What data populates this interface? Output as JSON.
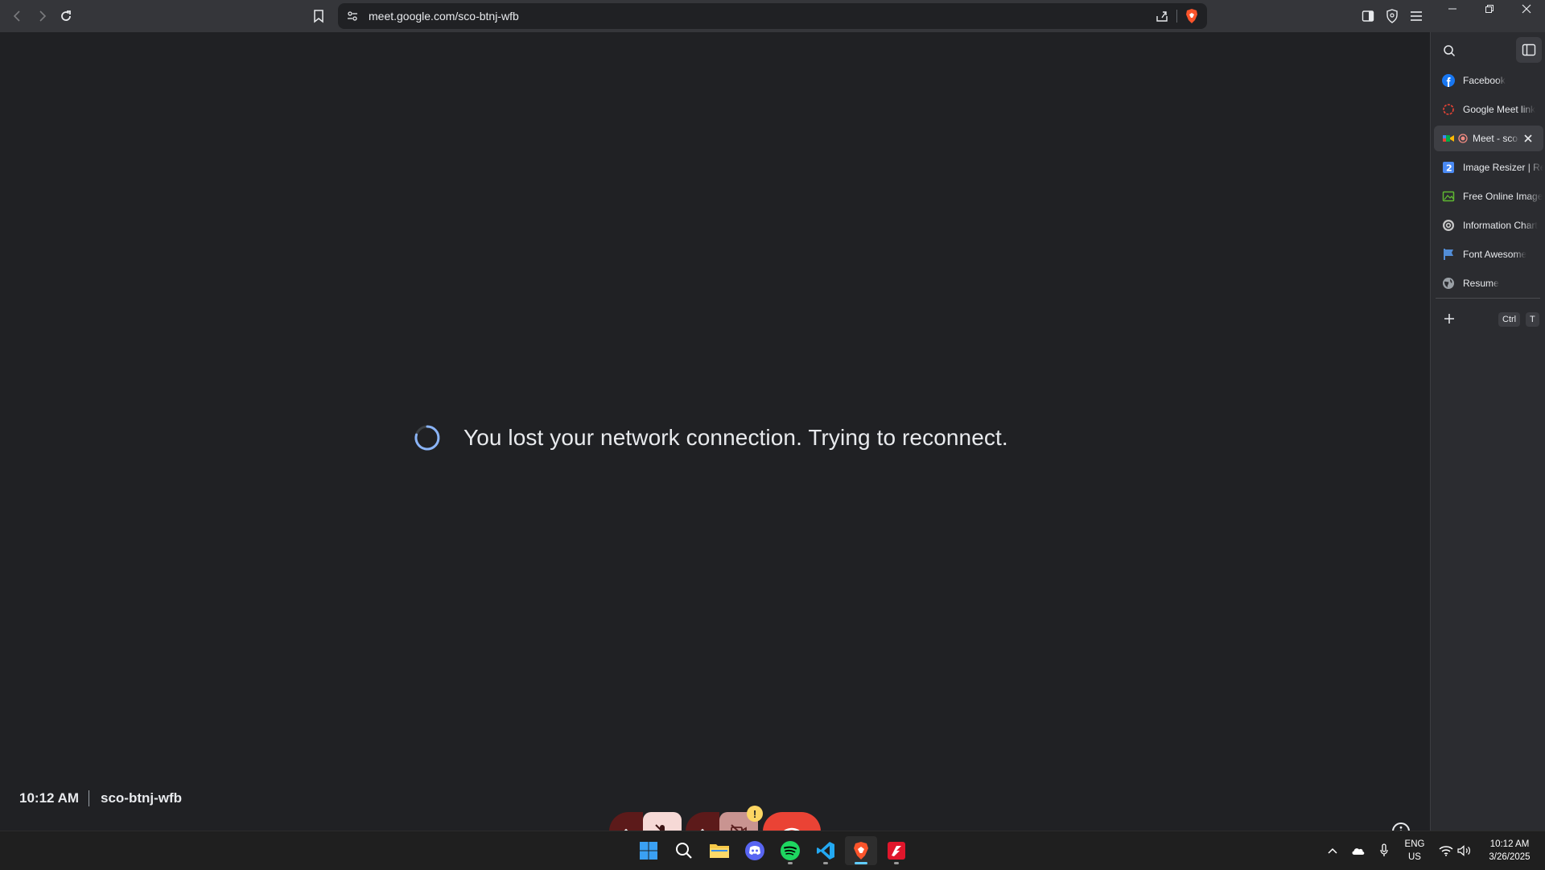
{
  "browser": {
    "url": "meet.google.com/sco-btnj-wfb"
  },
  "meet": {
    "reconnect_message": "You lost your network connection. Trying to reconnect.",
    "time": "10:12 AM",
    "meeting_code": "sco-btnj-wfb",
    "camera_warning": "!"
  },
  "sidebar": {
    "tabs": [
      {
        "label": "Facebook",
        "icon": "facebook-icon",
        "color": "#1877f2"
      },
      {
        "label": "Google Meet link",
        "icon": "ring-icon",
        "color": "#ea4335"
      },
      {
        "label": "Meet - sco-btnj-wfb",
        "icon": "meet-icon",
        "color": "#00ac47",
        "active": true
      },
      {
        "label": "Image Resizer | Resize",
        "icon": "resizer-icon",
        "color": "#4a8af4"
      },
      {
        "label": "Free Online Image",
        "icon": "image-icon",
        "color": "#5fb832"
      },
      {
        "label": "Information Chart",
        "icon": "settings-icon",
        "color": "#c8c8c8"
      },
      {
        "label": "Font Awesome",
        "icon": "flag-icon",
        "color": "#528dd7"
      },
      {
        "label": "Resume",
        "icon": "globe-icon",
        "color": "#9aa0a6"
      }
    ],
    "shortcut_key1": "Ctrl",
    "shortcut_key2": "T"
  },
  "taskbar": {
    "language": "ENG",
    "region": "US",
    "clock_time": "10:12 AM",
    "clock_date": "3/26/2025"
  },
  "colors": {
    "meet_bg": "#202124",
    "hangup": "#ea4335",
    "accent": "#8ab4f8"
  }
}
